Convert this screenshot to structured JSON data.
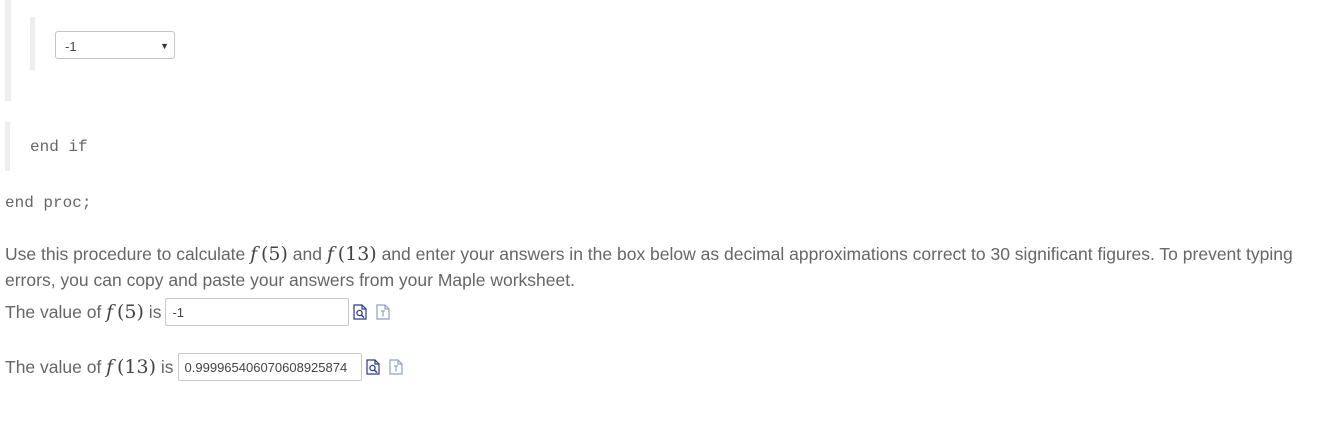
{
  "select": {
    "value": "-1",
    "caret": "▼"
  },
  "code": {
    "end_if": "end if",
    "end_proc": "end proc;"
  },
  "instructions": {
    "part1": "Use this procedure to calculate ",
    "f_name": "f",
    "arg_a": "(5)",
    "and": " and ",
    "arg_b": "(13)",
    "part2": " and enter your answers in the box below as decimal approximations correct to 30 significant figures. To prevent typing errors, you can copy and paste your answers from your Maple worksheet."
  },
  "answers": [
    {
      "prefix": "The value of ",
      "f_name": "f",
      "arg": "(5)",
      "suffix": " is",
      "value": "-1"
    },
    {
      "prefix": "The value of ",
      "f_name": "f",
      "arg": "(13)",
      "suffix": " is",
      "value": "0.999965406070608925874"
    }
  ],
  "icons": {
    "preview": "preview-math-icon",
    "help": "syntax-help-icon"
  },
  "colors": {
    "icon_dark": "#2b3a8c",
    "icon_light": "#8fa0c8",
    "border": "#c8c8c8",
    "text": "#666666"
  }
}
